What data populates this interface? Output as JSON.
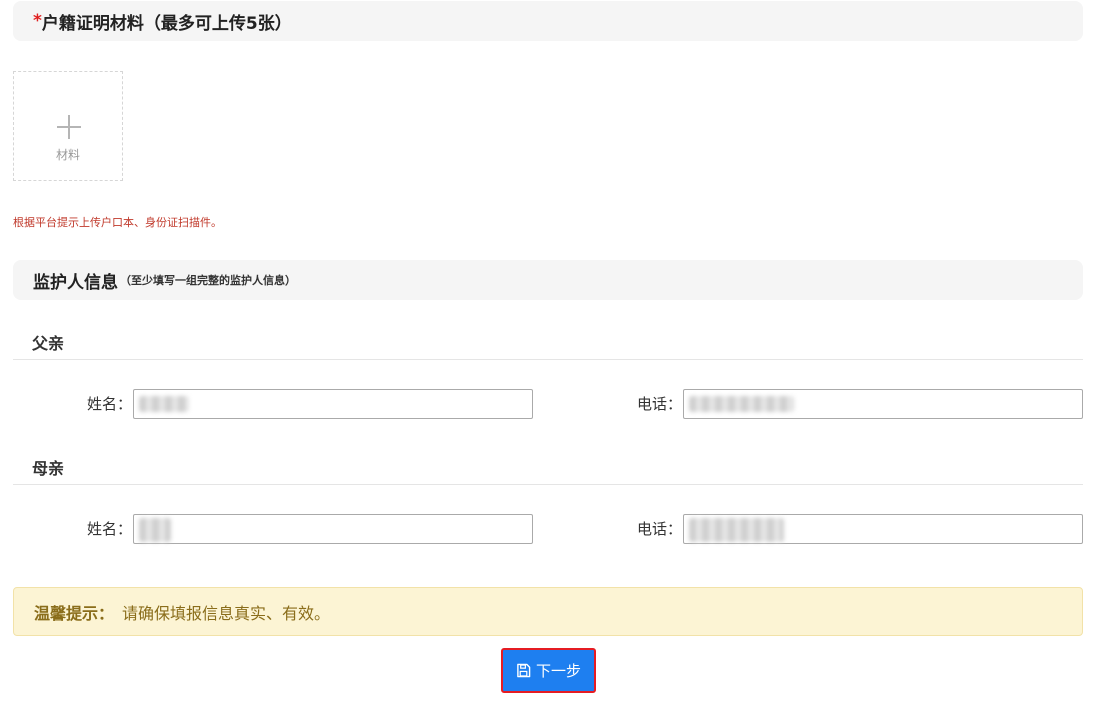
{
  "household_section": {
    "required_mark": "*",
    "title": "户籍证明材料（最多可上传5张）",
    "upload_label": "材料",
    "hint": "根据平台提示上传户口本、身份证扫描件。"
  },
  "guardian_section": {
    "title": "监护人信息",
    "subtitle": "（至少填写一组完整的监护人信息）",
    "father": {
      "title": "父亲",
      "name_label": "姓名：",
      "phone_label": "电话：",
      "name_value": "",
      "phone_value": ""
    },
    "mother": {
      "title": "母亲",
      "name_label": "姓名：",
      "phone_label": "电话：",
      "name_value": "",
      "phone_value": ""
    }
  },
  "tip": {
    "title": "温馨提示：",
    "text": "请确保填报信息真实、有效。"
  },
  "next_button": {
    "label": "下一步",
    "icon": "save-icon"
  },
  "colors": {
    "primary": "#1e7ff0",
    "required": "#e02020",
    "hint_red": "#c0392b",
    "tip_background": "#fcf4d4",
    "tip_text": "#8a6d1a",
    "button_border": "#e51c23"
  }
}
